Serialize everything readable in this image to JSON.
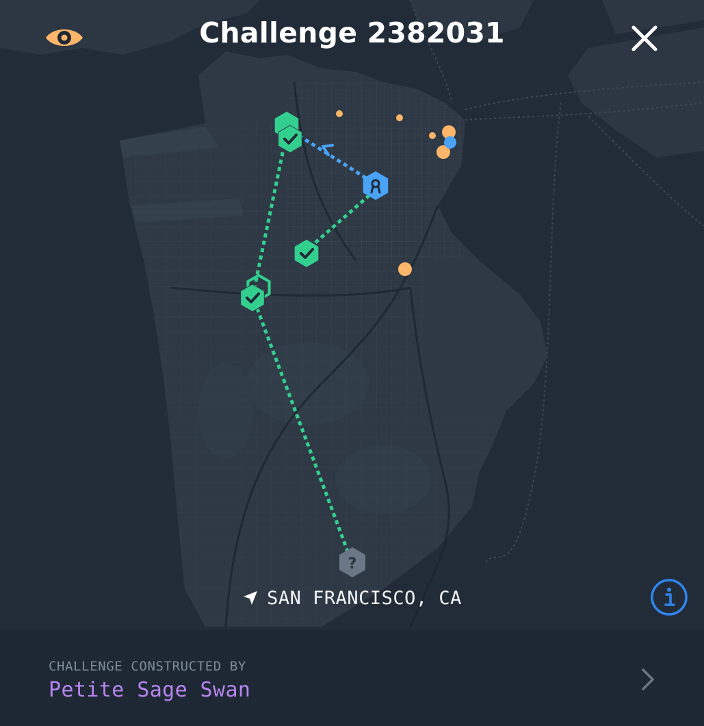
{
  "header": {
    "title": "Challenge 2382031",
    "visibility_icon": "eye-icon",
    "close_icon": "close-icon"
  },
  "map": {
    "location_icon": "navigation-arrow-icon",
    "location_label": "SAN FRANCISCO, CA",
    "info_icon": "info-icon",
    "node_states": {
      "completed": "check-icon",
      "current": "award-icon",
      "unknown": "question-icon"
    }
  },
  "footer": {
    "label": "CHALLENGE CONSTRUCTED BY",
    "author": "Petite Sage Swan",
    "chevron_icon": "chevron-right-icon"
  },
  "colors": {
    "background": "#1f2935",
    "land": "#2e3945",
    "water": "#222c38",
    "accent_orange": "#fdb66a",
    "complete_green": "#33cf8f",
    "current_blue": "#4aa3f7",
    "unknown_gray": "#6b7786",
    "author_purple": "#b685f0",
    "info_blue": "#2f86f0"
  }
}
